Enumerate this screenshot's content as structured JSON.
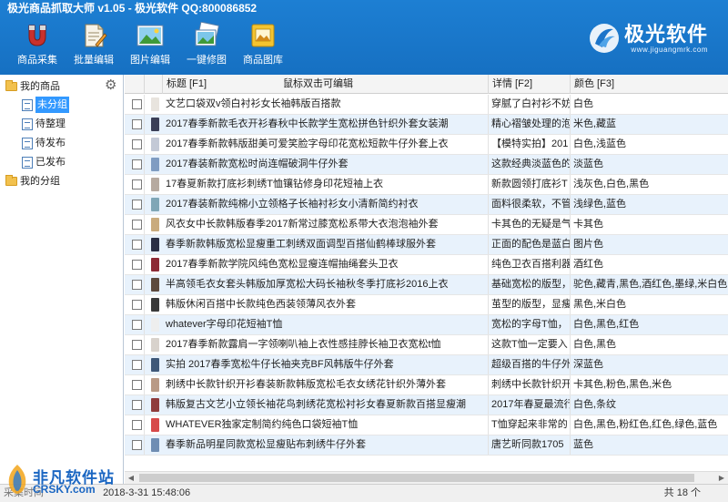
{
  "app": {
    "title": "极光商品抓取大师 v1.05 - 极光软件 QQ:800086852"
  },
  "toolbar": {
    "buttons": [
      {
        "label": "商品采集",
        "icon": "magnet-icon"
      },
      {
        "label": "批量编辑",
        "icon": "document-edit-icon"
      },
      {
        "label": "图片编辑",
        "icon": "image-icon"
      },
      {
        "label": "一键修图",
        "icon": "photo-stack-icon"
      },
      {
        "label": "商品图库",
        "icon": "gallery-icon"
      }
    ]
  },
  "logo": {
    "name": "极光软件",
    "url": "www.jiguangmrk.com"
  },
  "sidebar": {
    "root_label": "我的商品",
    "children": [
      "未分组",
      "待整理",
      "待发布",
      "已发布"
    ],
    "selected": "未分组",
    "group_label": "我的分组"
  },
  "grid": {
    "columns": {
      "title": "标题 [F1]",
      "title_hint": "鼠标双击可编辑",
      "detail": "详情 [F2]",
      "color": "颜色 [F3]"
    },
    "rows": [
      {
        "title": "文艺口袋双v领白衬衫女长袖韩版百搭款",
        "detail": "穿腻了白衬衫不妨",
        "color": "白色",
        "thumb": "#e8e4de"
      },
      {
        "title": "2017春季新款毛衣开衫春秋中长款学生宽松拼色针织外套女装潮",
        "detail": "精心褶皱处理的泡",
        "color": "米色,藏蓝",
        "thumb": "#3b3f57"
      },
      {
        "title": "2017春季新款韩版甜美可爱笑脸字母印花宽松短款牛仔外套上衣",
        "detail": "【模特实拍】201",
        "color": "白色,浅蓝色",
        "thumb": "#c3c9d6"
      },
      {
        "title": "2017春装新款宽松时尚连帽破洞牛仔外套",
        "detail": "这款经典淡蓝色的",
        "color": "淡蓝色",
        "thumb": "#7f9cc2"
      },
      {
        "title": "17春夏新款打底衫刺绣T恤镶钻修身印花短袖上衣",
        "detail": "新款圆领打底衫T",
        "color": "浅灰色,白色,黑色",
        "thumb": "#b6aaa0"
      },
      {
        "title": "2017春装新款纯棉小立领格子长袖衬衫女小清新简约衬衣",
        "detail": "面料很柔软，不管",
        "color": "浅绿色,蓝色",
        "thumb": "#7fa6b6"
      },
      {
        "title": "风衣女中长款韩版春季2017新常过膝宽松系带大衣泡泡袖外套",
        "detail": "卡其色的无疑是气",
        "color": "卡其色",
        "thumb": "#c9ab7e"
      },
      {
        "title": "春季新款韩版宽松显瘦重工刺绣双面调型百搭仙鹤棒球服外套",
        "detail": "正面的配色是蓝白",
        "color": "图片色",
        "thumb": "#2b2f44"
      },
      {
        "title": "2017春季新款学院风纯色宽松显瘦连帽抽绳套头卫衣",
        "detail": "纯色卫衣百搭利器",
        "color": "酒红色",
        "thumb": "#8d2a35"
      },
      {
        "title": "半高领毛衣女套头韩版加厚宽松大码长袖秋冬季打底衫2016上衣",
        "detail": "基础宽松的版型，",
        "color": "驼色,藏青,黑色,酒红色,墨绿,米白色",
        "thumb": "#5d4a3d"
      },
      {
        "title": "韩版休闲百搭中长款纯色西装领薄风衣外套",
        "detail": "茧型的版型，显瘦",
        "color": "黑色,米白色",
        "thumb": "#3a3a3a"
      },
      {
        "title": "whatever字母印花短袖T恤",
        "detail": "宽松的字母T恤，",
        "color": "白色,黑色,红色",
        "thumb": "#eeeeee"
      },
      {
        "title": "2017春季新款露肩一字领喇叭袖上衣性感挂脖长袖卫衣宽松t恤",
        "detail": "这款T恤一定要入",
        "color": "白色,黑色",
        "thumb": "#d8d2cc"
      },
      {
        "title": "实拍 2017春季宽松牛仔长袖夹克BF风韩版牛仔外套",
        "detail": "超级百搭的牛仔外",
        "color": "深蓝色",
        "thumb": "#3f5878"
      },
      {
        "title": "刺绣中长款针织开衫春装新款韩版宽松毛衣女绣花针织外薄外套",
        "detail": "刺绣中长款针织开",
        "color": "卡其色,粉色,黑色,米色",
        "thumb": "#b99a86"
      },
      {
        "title": "韩版复古文艺小立领长袖花鸟刺绣花宽松衬衫女春夏新款百搭显瘦潮",
        "detail": "2017年春夏最流行",
        "color": "白色,条纹",
        "thumb": "#8f3c3c"
      },
      {
        "title": "WHATEVER独家定制简约纯色口袋短袖T恤",
        "detail": "T恤穿起来非常的",
        "color": "白色,黑色,粉红色,红色,绿色,蓝色",
        "thumb": "#d74a4a"
      },
      {
        "title": "春季新品明星同款宽松显瘦贴布刺绣牛仔外套",
        "detail": "唐艺昕同款1705",
        "color": "蓝色",
        "thumb": "#6f8db3"
      }
    ]
  },
  "status": {
    "left": "实时时间：2018-3-31 15:48:06",
    "left_visible": "2018-3-31 15:48:06",
    "left_prefix": "采集时间",
    "right": "共 18 个"
  },
  "watermark": {
    "cn": "非凡软件站",
    "en": "CRSKY.com"
  }
}
